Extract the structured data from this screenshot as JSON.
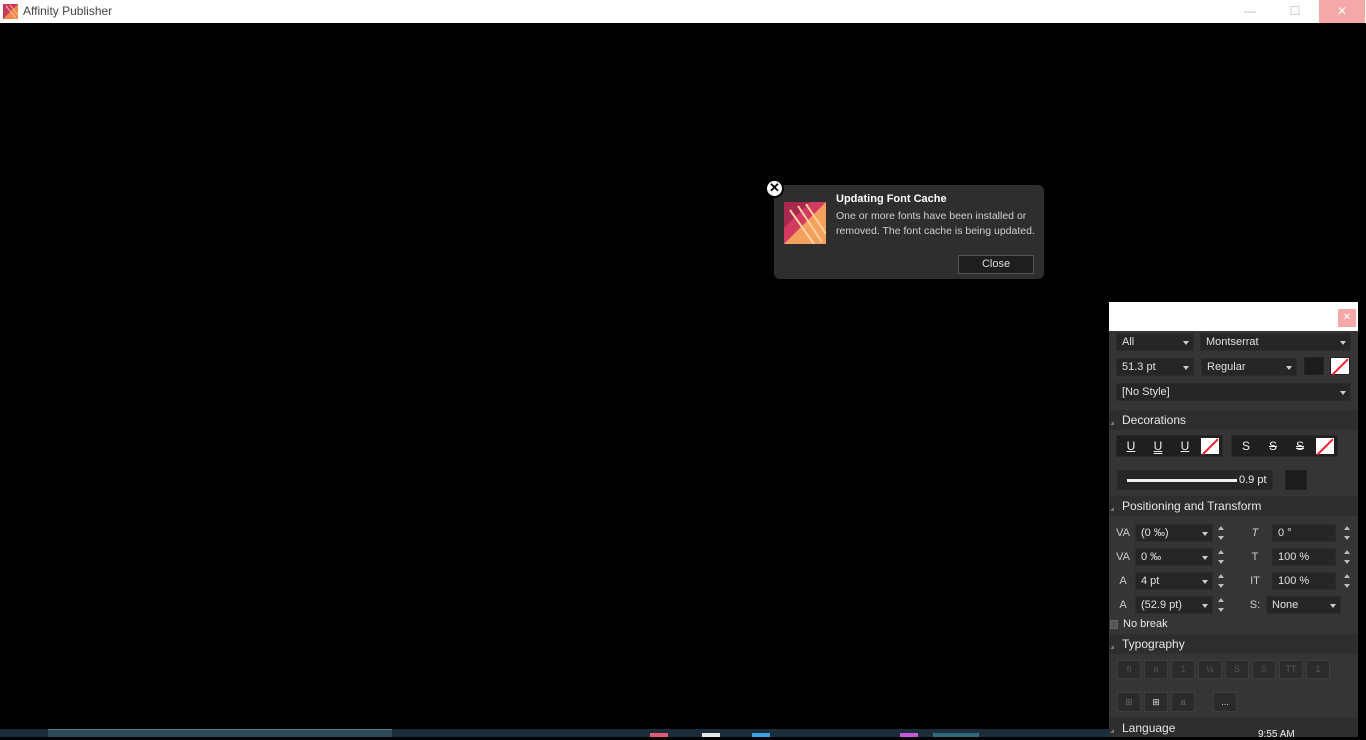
{
  "window": {
    "title": "Affinity Publisher",
    "minimize": "—",
    "maximize": "☐",
    "close": "✕"
  },
  "toast": {
    "title": "Updating Font Cache",
    "body": "One or more fonts have been installed or removed. The font cache is being updated.",
    "close_label": "Close",
    "dismiss_symbol": "✕"
  },
  "panel": {
    "close_symbol": "✕",
    "scope": "All",
    "font_family": "Montserrat",
    "font_size": "51.3 pt",
    "font_weight": "Regular",
    "paragraph_style": "[No Style]",
    "sections": {
      "decorations": "Decorations",
      "positioning": "Positioning and Transform",
      "typography": "Typography",
      "language": "Language"
    },
    "underline_buttons": [
      "U",
      "U",
      "U"
    ],
    "strike_buttons": [
      "S",
      "S",
      "S"
    ],
    "line_weight": "0.9 pt",
    "positioning": {
      "kerning": "(0 ‰)",
      "tracking": "0 ‰",
      "baseline": "4 pt",
      "leading": "(52.9 pt)",
      "skew": "0 °",
      "vertical_scale": "100 %",
      "horizontal_scale": "100 %",
      "style": "None",
      "style_label": "S:"
    },
    "no_break": "No break",
    "typography_more": "..."
  },
  "taskbar": {
    "clock": "9:55 AM"
  },
  "colors": {
    "accent_logo": "#f08a4b",
    "logo_dark": "#c8385a",
    "panel_bg": "#353535",
    "close_hover": "#f4a8a8"
  }
}
